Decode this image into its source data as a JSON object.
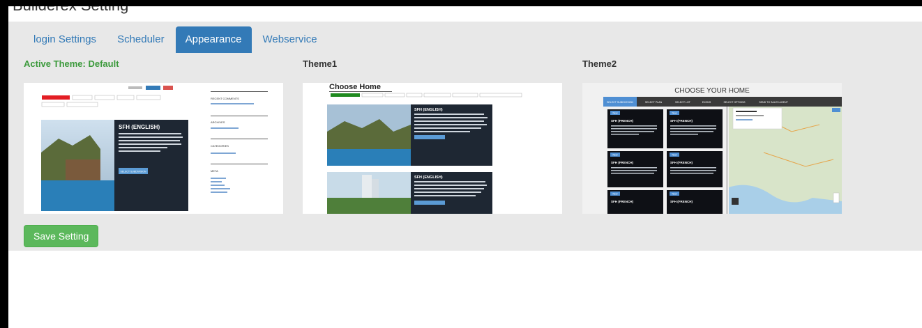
{
  "page": {
    "title": "Builderex Setting"
  },
  "tabs": [
    {
      "label": "login Settings",
      "active": false
    },
    {
      "label": "Scheduler",
      "active": false
    },
    {
      "label": "Appearance",
      "active": true
    },
    {
      "label": "Webservice",
      "active": false
    }
  ],
  "themes": [
    {
      "label": "Active Theme: Default",
      "active": true
    },
    {
      "label": "Theme1",
      "active": false
    },
    {
      "label": "Theme2",
      "active": false
    }
  ],
  "preview_default": {
    "hero_title": "SFH (ENGLISH)",
    "cta": "SELECT SUBDIVISION",
    "widgets": [
      "RECENT COMMENTS",
      "ARCHIVES",
      "CATEGORIES",
      "META"
    ]
  },
  "preview_theme1": {
    "heading": "Choose Home",
    "card_title": "SFH (ENGLISH)"
  },
  "preview_theme2": {
    "heading": "CHOOSE YOUR HOME",
    "nav": [
      "SELECT SUBDIVISION",
      "SELECT PLAN",
      "SELECT LOT",
      "EXONS",
      "SELECT OPTIONS",
      "SEND TO SALES AGENT"
    ],
    "card_title": "SFH (FRENCH)",
    "badge": "New"
  },
  "actions": {
    "save_label": "Save Setting"
  },
  "colors": {
    "primary": "#337ab7",
    "success": "#5cb85c",
    "active_theme": "#3c9a3c",
    "panel": "#e8e8e8"
  }
}
